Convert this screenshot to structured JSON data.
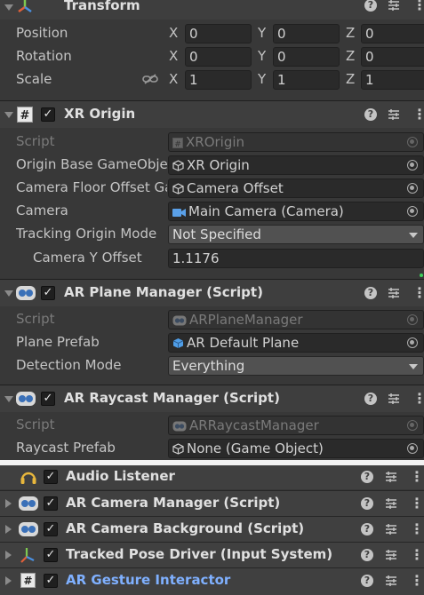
{
  "transform": {
    "title": "Transform",
    "position_label": "Position",
    "rotation_label": "Rotation",
    "scale_label": "Scale",
    "axis_x": "X",
    "axis_y": "Y",
    "axis_z": "Z",
    "position": {
      "x": "0",
      "y": "0",
      "z": "0"
    },
    "rotation": {
      "x": "0",
      "y": "0",
      "z": "0"
    },
    "scale": {
      "x": "1",
      "y": "1",
      "z": "1"
    }
  },
  "xr_origin": {
    "title": "XR Origin",
    "script_label": "Script",
    "script_value": "XROrigin",
    "origin_base_label": "Origin Base GameObject",
    "origin_base_value": "XR Origin",
    "camera_floor_label": "Camera Floor Offset GameObject",
    "camera_floor_value": "Camera Offset",
    "camera_label": "Camera",
    "camera_value": "Main Camera (Camera)",
    "tracking_mode_label": "Tracking Origin Mode",
    "tracking_mode_value": "Not Specified",
    "camera_y_offset_label": "Camera Y Offset",
    "camera_y_offset_value": "1.1176"
  },
  "ar_plane_manager": {
    "title": "AR Plane Manager (Script)",
    "script_label": "Script",
    "script_value": "ARPlaneManager",
    "plane_prefab_label": "Plane Prefab",
    "plane_prefab_value": "AR Default Plane",
    "detection_mode_label": "Detection Mode",
    "detection_mode_value": "Everything"
  },
  "ar_raycast_manager": {
    "title": "AR Raycast Manager (Script)",
    "script_label": "Script",
    "script_value": "ARRaycastManager",
    "raycast_prefab_label": "Raycast Prefab",
    "raycast_prefab_value": "None (Game Object)"
  },
  "collapsed_components": [
    {
      "title": "Audio Listener"
    },
    {
      "title": "AR Camera Manager (Script)"
    },
    {
      "title": "AR Camera Background (Script)"
    },
    {
      "title": "Tracked Pose Driver (Input System)"
    },
    {
      "title": "AR Gesture Interactor"
    }
  ],
  "header_icons": {
    "help": "?",
    "checkmark": "✓",
    "menu": "⋮"
  },
  "colors": {
    "accent_blue": "#7fb0ff",
    "background": "#383838",
    "header": "#3e3e3e"
  }
}
